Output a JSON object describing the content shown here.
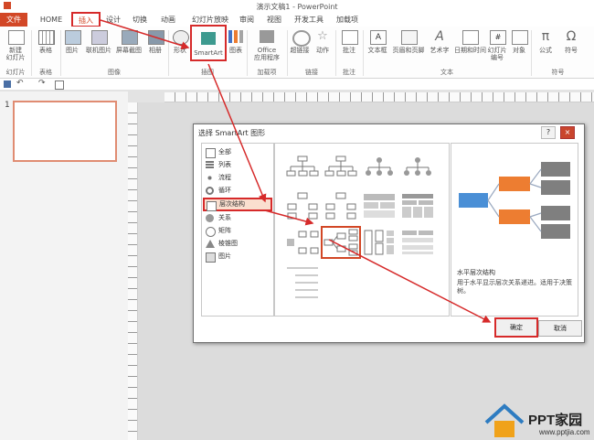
{
  "title": "演示文稿1 - PowerPoint",
  "tabs": [
    "文件",
    "HOME",
    "插入",
    "设计",
    "切换",
    "动画",
    "幻灯片放映",
    "审阅",
    "视图",
    "开发工具",
    "加载项"
  ],
  "ribbon": {
    "buttons": [
      "新建\n幻灯片",
      "表格",
      "图片",
      "联机图片",
      "屏幕截图",
      "相册",
      "形状",
      "SmartArt",
      "图表",
      "Office\n应用程序",
      "超链接",
      "动作",
      "批注",
      "文本框",
      "页眉和页脚",
      "艺术字",
      "日期和时间",
      "幻灯片\n编号",
      "对象",
      "公式",
      "符号"
    ],
    "groups": [
      "幻灯片",
      "表格",
      "图像",
      "插图",
      "加载项",
      "链接",
      "批注",
      "文本",
      "符号"
    ]
  },
  "thumbnail": {
    "number": "1"
  },
  "dialog": {
    "title": "选择 SmartArt 图形",
    "help": "?",
    "close": "×",
    "categories": [
      "全部",
      "列表",
      "流程",
      "循环",
      "层次结构",
      "关系",
      "矩阵",
      "棱锥图",
      "图片"
    ],
    "selected_category": "层次结构",
    "preview_title": "水平层次结构",
    "preview_desc": "用于水平显示层次关系递进。适用于决策树。",
    "ok": "确定",
    "cancel": "取消"
  },
  "logo": {
    "text": "PPT家园",
    "url": "www.pptjia.com"
  },
  "colors": {
    "accent": "#d24726",
    "highlight": "#d62a2a",
    "preview_orange": "#ed7d31",
    "preview_blue": "#4a8fd6",
    "preview_gray": "#7f7f7f"
  }
}
